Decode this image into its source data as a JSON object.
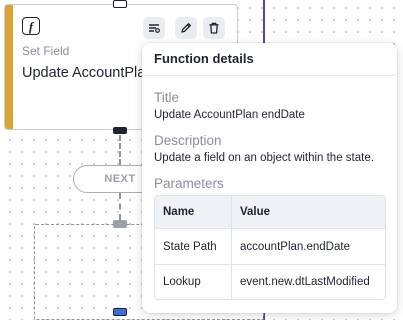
{
  "node": {
    "icon": "function-icon",
    "icon_glyph": "f",
    "type_label": "Set Field",
    "title": "Update AccountPlan endDate",
    "accent_color": "#d9a431",
    "toolbar": {
      "details_icon": "details-icon",
      "edit_icon": "pencil-icon",
      "delete_icon": "trash-icon"
    }
  },
  "connector": {
    "next_label": "NEXT"
  },
  "popover": {
    "heading": "Function details",
    "title_label": "Title",
    "title_value": "Update AccountPlan endDate",
    "description_label": "Description",
    "description_value": "Update a field on an object within the state.",
    "parameters_label": "Parameters",
    "table": {
      "headers": [
        "Name",
        "Value"
      ],
      "rows": [
        {
          "name": "State Path",
          "value": "accountPlan.endDate"
        },
        {
          "name": "Lookup",
          "value": "event.new.dtLastModified"
        }
      ]
    }
  },
  "colors": {
    "guide_line": "#5a3fa8",
    "handle_blue": "#3b6fd8"
  }
}
